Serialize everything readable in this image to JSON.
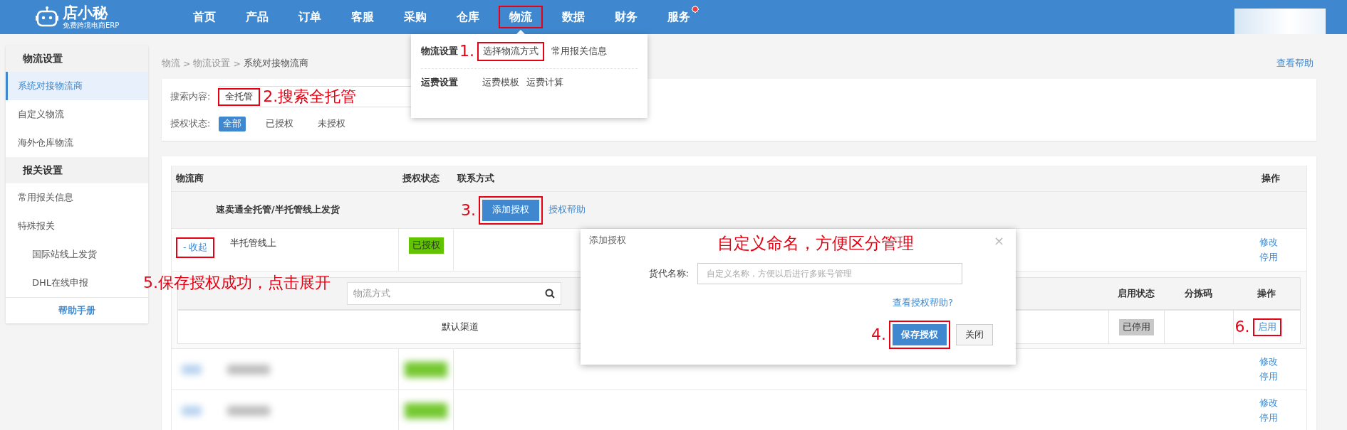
{
  "top_nav": {
    "logo": {
      "name": "店小秘",
      "tagline": "免费跨境电商ERP"
    },
    "items": [
      {
        "label": "首页",
        "selected": false,
        "has_dot": false,
        "boxed": false
      },
      {
        "label": "产品",
        "selected": false,
        "has_dot": false,
        "boxed": false
      },
      {
        "label": "订单",
        "selected": false,
        "has_dot": false,
        "boxed": false
      },
      {
        "label": "客服",
        "selected": false,
        "has_dot": false,
        "boxed": false
      },
      {
        "label": "采购",
        "selected": false,
        "has_dot": false,
        "boxed": false
      },
      {
        "label": "仓库",
        "selected": false,
        "has_dot": false,
        "boxed": false
      },
      {
        "label": "物流",
        "selected": true,
        "has_dot": false,
        "boxed": true
      },
      {
        "label": "数据",
        "selected": false,
        "has_dot": false,
        "boxed": false
      },
      {
        "label": "财务",
        "selected": false,
        "has_dot": false,
        "boxed": false
      },
      {
        "label": "服务",
        "selected": false,
        "has_dot": true,
        "boxed": false
      }
    ]
  },
  "sidebar": {
    "sections": [
      {
        "title": "物流设置",
        "items": [
          {
            "label": "系统对接物流商",
            "selected": true
          },
          {
            "label": "自定义物流",
            "selected": false
          },
          {
            "label": "海外仓库物流",
            "selected": false
          }
        ]
      },
      {
        "title": "报关设置",
        "items": [
          {
            "label": "常用报关信息",
            "selected": false
          },
          {
            "label": "特殊报关",
            "selected": false,
            "children": [
              {
                "label": "国际站线上发货",
                "selected": false
              },
              {
                "label": "DHL在线申报",
                "selected": false
              }
            ]
          }
        ]
      }
    ],
    "help": "帮助手册"
  },
  "breadcrumb": {
    "items": [
      "物流",
      "物流设置",
      "系统对接物流商"
    ],
    "separator": ">"
  },
  "help_link": "查看帮助",
  "search": {
    "label": "搜索内容:",
    "value": "全托管",
    "boxed": true,
    "callout": "2.搜索全托管"
  },
  "auth_filter": {
    "label": "授权状态:",
    "options": [
      {
        "label": "全部",
        "selected": true
      },
      {
        "label": "已授权",
        "selected": false
      },
      {
        "label": "未授权",
        "selected": false
      }
    ]
  },
  "table": {
    "columns": [
      "物流商",
      "授权状态",
      "联系方式",
      "操作"
    ],
    "group": {
      "title": "速卖通全托管/半托管线上发货",
      "add_button": {
        "label": "添加授权",
        "boxed": true,
        "callout": "3."
      },
      "help_link": "授权帮助"
    },
    "rows": [
      {
        "kind": "account",
        "toggle": {
          "label": "- 收起",
          "boxed": true,
          "callout": "5.保存授权成功，点击展开"
        },
        "name": "半托管线上",
        "status": "已授权",
        "actions": [
          "修改",
          "停用"
        ],
        "expanded": true,
        "channels": {
          "search_placeholder": "物流方式",
          "columns": [
            "启用状态",
            "分拣码",
            "操作"
          ],
          "rows": [
            {
              "name": "默认渠道",
              "status": "已停用",
              "action": {
                "label": "启用",
                "boxed": true,
                "callout": "6."
              }
            }
          ]
        }
      },
      {
        "kind": "blurred",
        "actions": [
          "修改",
          "停用"
        ]
      },
      {
        "kind": "blurred",
        "actions": [
          "修改",
          "停用"
        ]
      }
    ]
  },
  "menu": {
    "groups": [
      {
        "title": "物流设置",
        "items": [
          {
            "label": "选择物流方式",
            "boxed": true,
            "callout": "1."
          },
          {
            "label": "常用报关信息",
            "boxed": false
          }
        ]
      },
      {
        "title": "运费设置",
        "items": [
          {
            "label": "运费模板",
            "boxed": false
          },
          {
            "label": "运费计算",
            "boxed": false
          }
        ]
      }
    ]
  },
  "dialog": {
    "title": "添加授权",
    "close": "×",
    "callout": "自定义命名，方便区分管理",
    "field": {
      "label": "货代名称:",
      "placeholder": "自定义名称，方便以后进行多账号管理"
    },
    "help_link": "查看授权帮助?",
    "buttons": [
      {
        "label": "保存授权",
        "kind": "primary",
        "boxed": true,
        "callout": "4."
      },
      {
        "label": "关闭",
        "kind": "default",
        "boxed": false
      }
    ]
  }
}
